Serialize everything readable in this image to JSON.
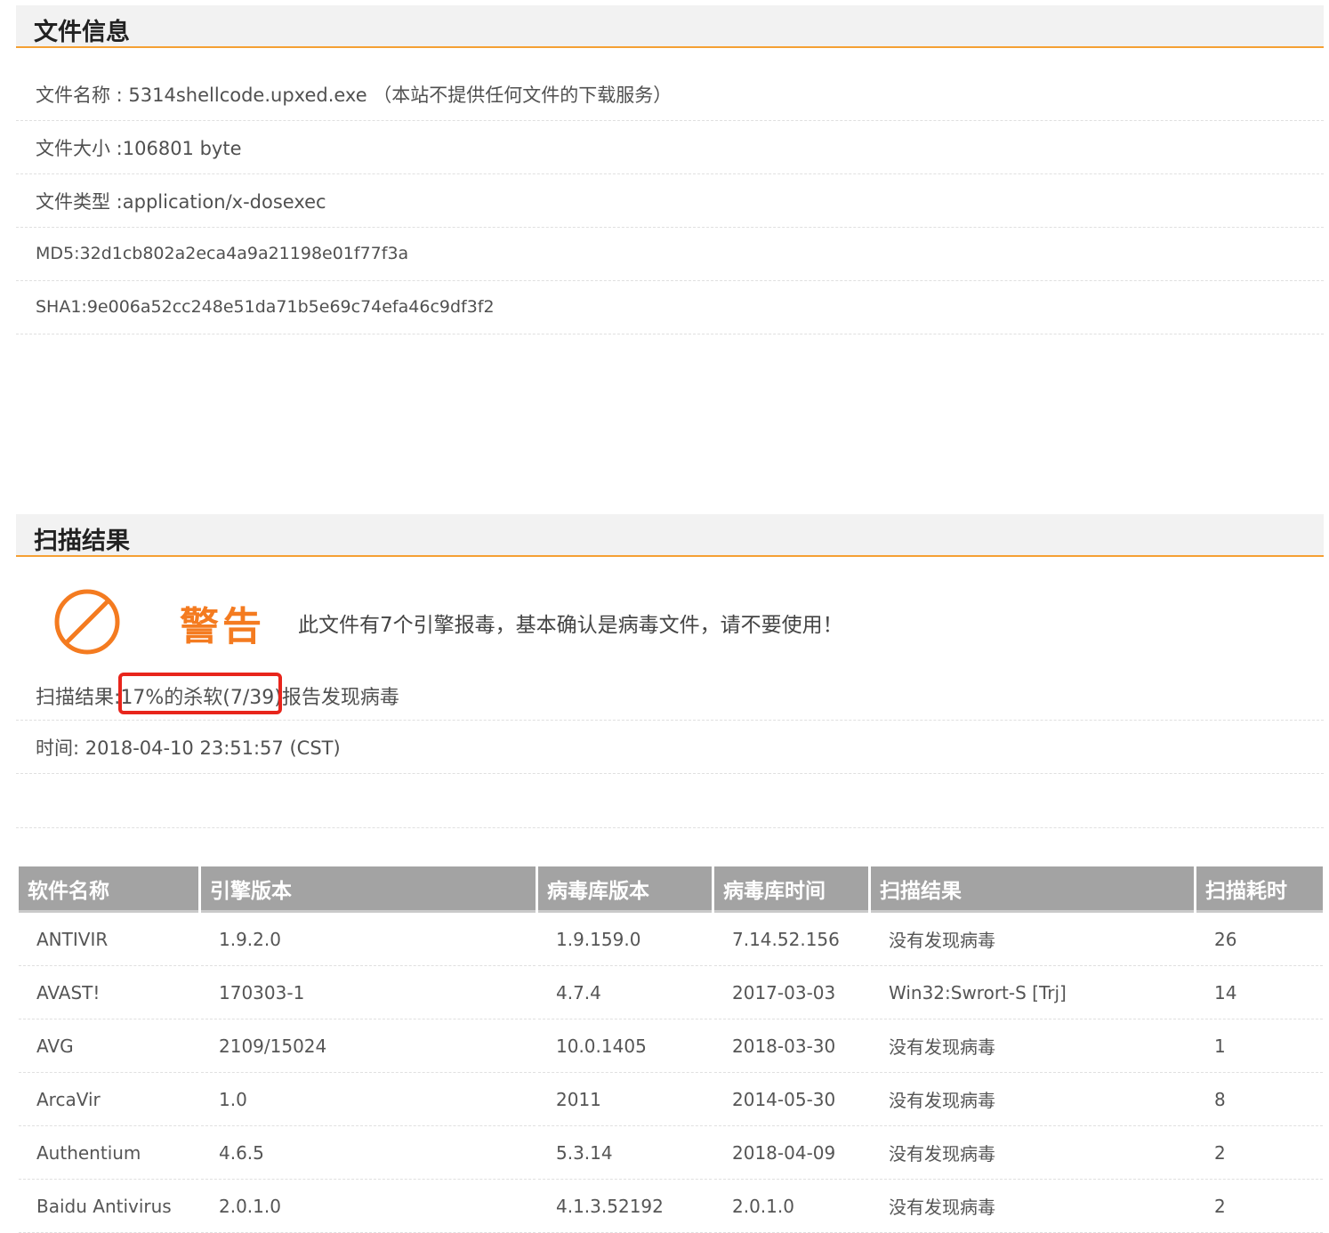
{
  "file_info": {
    "header": "文件信息",
    "name": "文件名称 : 5314shellcode.upxed.exe （本站不提供任何文件的下载服务）",
    "size": "文件大小 :106801 byte",
    "type": "文件类型 :application/x-dosexec",
    "md5": "MD5:32d1cb802a2eca4a9a21198e01f77f3a",
    "sha1": "SHA1:9e006a52cc248e51da71b5e69c74efa46c9df3f2"
  },
  "scan": {
    "header": "扫描结果",
    "warning_title": "警告",
    "warning_message": "此文件有7个引擎报毒，基本确认是病毒文件，请不要使用！",
    "result_line": "扫描结果:17%的杀软(7/39)报告发现病毒",
    "time_line": "时间: 2018-04-10 23:51:57 (CST)",
    "detection_ratio": "7/39",
    "columns": [
      "软件名称",
      "引擎版本",
      "病毒库版本",
      "病毒库时间",
      "扫描结果",
      "扫描耗时"
    ],
    "rows": [
      {
        "name": "ANTIVIR",
        "engine": "1.9.2.0",
        "db_version": "1.9.159.0",
        "db_time": "7.14.52.156",
        "result": "没有发现病毒",
        "time": "26"
      },
      {
        "name": "AVAST!",
        "engine": "170303-1",
        "db_version": "4.7.4",
        "db_time": "2017-03-03",
        "result": "Win32:Swrort-S [Trj]",
        "time": "14"
      },
      {
        "name": "AVG",
        "engine": "2109/15024",
        "db_version": "10.0.1405",
        "db_time": "2018-03-30",
        "result": "没有发现病毒",
        "time": "1"
      },
      {
        "name": "ArcaVir",
        "engine": "1.0",
        "db_version": "2011",
        "db_time": "2014-05-30",
        "result": "没有发现病毒",
        "time": "8"
      },
      {
        "name": "Authentium",
        "engine": "4.6.5",
        "db_version": "5.3.14",
        "db_time": "2018-04-09",
        "result": "没有发现病毒",
        "time": "2"
      },
      {
        "name": "Baidu Antivirus",
        "engine": "2.0.1.0",
        "db_version": "4.1.3.52192",
        "db_time": "2.0.1.0",
        "result": "没有发现病毒",
        "time": "2"
      }
    ]
  },
  "colors": {
    "accent": "#f5a033",
    "warning": "#f47b20",
    "clean": "#169e16",
    "virus": "#e02020",
    "highlight": "#e8251c",
    "table_header": "#a3a3a3"
  }
}
